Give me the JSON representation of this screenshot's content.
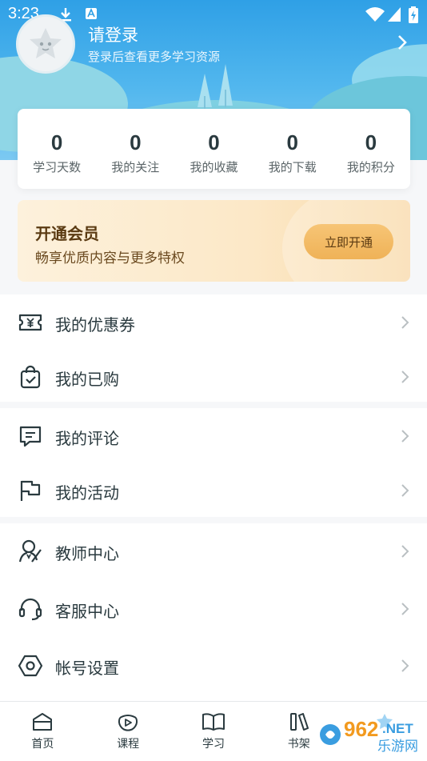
{
  "status_bar": {
    "time": "3:23"
  },
  "profile": {
    "title": "请登录",
    "subtitle": "登录后查看更多学习资源"
  },
  "stats": [
    {
      "value": "0",
      "label": "学习天数"
    },
    {
      "value": "0",
      "label": "我的关注"
    },
    {
      "value": "0",
      "label": "我的收藏"
    },
    {
      "value": "0",
      "label": "我的下载"
    },
    {
      "value": "0",
      "label": "我的积分"
    }
  ],
  "vip": {
    "title": "开通会员",
    "subtitle": "畅享优质内容与更多特权",
    "button": "立即开通"
  },
  "menu": {
    "coupons": "我的优惠券",
    "purchased": "我的已购",
    "comments": "我的评论",
    "activities": "我的活动",
    "teacher": "教师中心",
    "service": "客服中心",
    "settings": "帐号设置"
  },
  "tabs": [
    {
      "label": "首页",
      "icon": "home-icon"
    },
    {
      "label": "课程",
      "icon": "course-play-icon"
    },
    {
      "label": "学习",
      "icon": "book-open-icon"
    },
    {
      "label": "书架",
      "icon": "bookshelf-icon"
    },
    {
      "label": "",
      "icon": "mine-icon"
    }
  ],
  "watermark": {
    "text1": "962",
    "text2": ".NET",
    "text3": "乐游网"
  },
  "colors": {
    "header": "#2fa0e6",
    "vip_button": "#efb257",
    "accent_text": "#2a3a3f"
  }
}
